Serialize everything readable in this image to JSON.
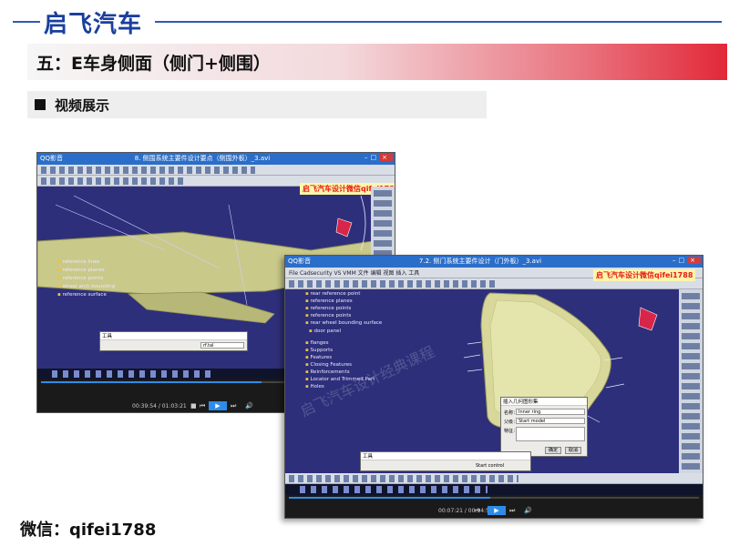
{
  "header": {
    "brand": "启飞汽车"
  },
  "section": {
    "title": "五：E车身侧面（侧门+侧围）"
  },
  "subsection": {
    "title": "视频展示"
  },
  "footer": {
    "wechat": "微信：qifei1788"
  },
  "colors": {
    "brand_blue": "#1a3f9c",
    "banner_red": "#e22838",
    "catia_bg": "#2e2f7a",
    "watermark_red": "#e41c1c"
  },
  "screenshot1": {
    "app_name": "QQ影音",
    "window_title": "8. 侧围系统主要件设计要点（侧围外板）_3.avi",
    "watermark": "启飞汽车设计微信qifei1788",
    "tree_items": [
      "reference lines",
      "reference planes",
      "reference points",
      "wheel arch bounding",
      "reference surface"
    ],
    "dialog_title": "工具",
    "dialog_field": "rf.tal",
    "player": {
      "time": "00:39:54 / 01:03:21",
      "progress": 0.63
    }
  },
  "screenshot2": {
    "app_name": "QQ影音",
    "window_title": "7.2. 侧门系统主要件设计（门外板）_3.avi",
    "watermark": "启飞汽车设计微信qifei1788",
    "menu": "File  Cadsecurity  VS  VMM  文件  编辑  视图  插入  工具",
    "tree_items": [
      "rear reference point",
      "reference planes",
      "reference points",
      "reference points",
      "rear wheel bounding surface",
      "door panel",
      "flanges",
      "Supports",
      "Features",
      "Closing Features",
      "Reinforcements",
      "Locator and Trimmed Part",
      "Holes"
    ],
    "dialog": {
      "title": "插入几何图形集",
      "name_label": "名称：",
      "name_value": "Inner ring",
      "parent_label": "父级：",
      "parent_value": "Start model",
      "child_label": "特征：",
      "ok": "确定",
      "cancel": "取消"
    },
    "mini_dialog_title": "工具",
    "mini_dialog_text": "Start control",
    "player": {
      "time": "00:07:21 / 00:14:58",
      "progress": 0.49
    }
  }
}
